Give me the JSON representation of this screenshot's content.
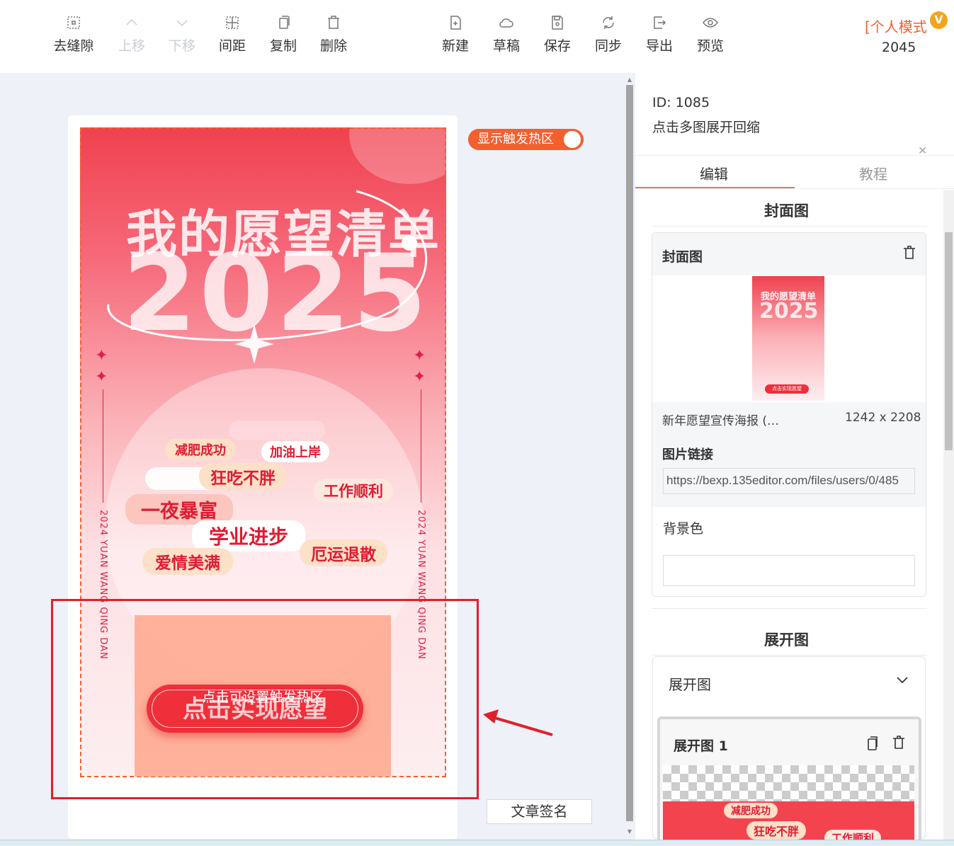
{
  "toolbar": {
    "left_tools": [
      {
        "label": "去缝隙",
        "icon": "gap-icon",
        "disabled": false
      },
      {
        "label": "上移",
        "icon": "chevron-up-icon",
        "disabled": true
      },
      {
        "label": "下移",
        "icon": "chevron-down-icon",
        "disabled": true
      },
      {
        "label": "间距",
        "icon": "spacing-icon",
        "disabled": false
      },
      {
        "label": "复制",
        "icon": "copy-icon",
        "disabled": false
      },
      {
        "label": "删除",
        "icon": "trash-icon",
        "disabled": false
      }
    ],
    "right_tools": [
      {
        "label": "新建",
        "icon": "new-file-icon"
      },
      {
        "label": "草稿",
        "icon": "cloud-icon"
      },
      {
        "label": "保存",
        "icon": "save-icon"
      },
      {
        "label": "同步",
        "icon": "sync-icon"
      },
      {
        "label": "导出",
        "icon": "export-icon"
      },
      {
        "label": "预览",
        "icon": "eye-icon"
      }
    ],
    "mode": "[个人模式",
    "badge": "V",
    "year": "2045"
  },
  "canvas": {
    "toggle_label": "显示触发热区",
    "poster": {
      "title": "我的愿望清单",
      "year": "2025",
      "side_text": "2024 YUAN WANG QING DAN",
      "wishes": [
        "减肥成功",
        "加油上岸",
        "狂吃不胖",
        "工作顺利",
        "一夜暴富",
        "学业进步",
        "爱情美满",
        "厄运退散"
      ],
      "cta": "点击实现愿望"
    },
    "hotzone_label": "点击可设置触发热区",
    "sign_button": "文章签名"
  },
  "panel": {
    "id_text": "ID: 1085",
    "desc": "点击多图展开回缩",
    "tabs": [
      "编辑",
      "教程"
    ],
    "cover_section_title": "封面图",
    "cover_card_title": "封面图",
    "cover_file_name": "新年愿望宣传海报 (…",
    "cover_file_size": "1242 x 2208",
    "link_label": "图片链接",
    "link_value": "https://bexp.135editor.com/files/users/0/485",
    "bg_label": "背景色",
    "expand_section_title": "展开图",
    "expand_label": "展开图",
    "expand_item_title": "展开图 1",
    "thumb_title": "我的愿望清单",
    "thumb_year": "2025",
    "thumb_cta": "点击实现愿望",
    "mini_wishes": [
      "减肥成功",
      "狂吃不胖",
      "工作顺利"
    ]
  },
  "colors": {
    "accent": "#f2602f",
    "frame_red": "#e0202a",
    "poster_red": "#ef2f3a"
  }
}
